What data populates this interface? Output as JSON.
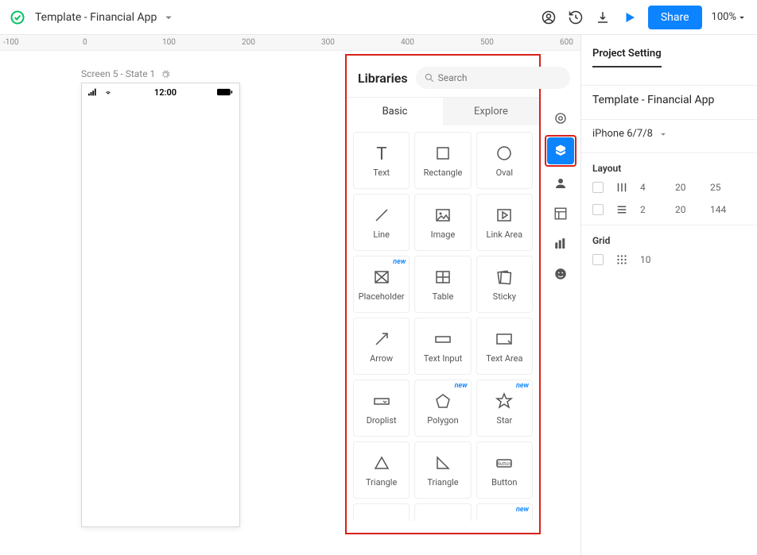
{
  "topbar": {
    "title": "Template - Financial App",
    "share_label": "Share",
    "zoom": "100%"
  },
  "ruler": {
    "ticks": [
      "-100",
      "0",
      "100",
      "200",
      "300",
      "400",
      "500",
      "600"
    ]
  },
  "canvas": {
    "screen_label": "Screen 5 - State 1",
    "status_time": "12:00"
  },
  "libraries": {
    "title": "Libraries",
    "search_placeholder": "Search",
    "tabs": {
      "basic": "Basic",
      "explore": "Explore"
    },
    "items": [
      {
        "label": "Text",
        "icon": "text",
        "new": false
      },
      {
        "label": "Rectangle",
        "icon": "rect",
        "new": false
      },
      {
        "label": "Oval",
        "icon": "oval",
        "new": false
      },
      {
        "label": "Line",
        "icon": "line",
        "new": false
      },
      {
        "label": "Image",
        "icon": "image",
        "new": false
      },
      {
        "label": "Link Area",
        "icon": "linkarea",
        "new": false
      },
      {
        "label": "Placeholder",
        "icon": "placeholder",
        "new": true
      },
      {
        "label": "Table",
        "icon": "table",
        "new": false
      },
      {
        "label": "Sticky",
        "icon": "sticky",
        "new": false
      },
      {
        "label": "Arrow",
        "icon": "arrow",
        "new": false
      },
      {
        "label": "Text Input",
        "icon": "textinput",
        "new": false
      },
      {
        "label": "Text Area",
        "icon": "textarea",
        "new": false
      },
      {
        "label": "Droplist",
        "icon": "droplist",
        "new": false
      },
      {
        "label": "Polygon",
        "icon": "polygon",
        "new": true
      },
      {
        "label": "Star",
        "icon": "star",
        "new": true
      },
      {
        "label": "Triangle",
        "icon": "triangle",
        "new": false
      },
      {
        "label": "Triangle",
        "icon": "triangle-r",
        "new": false
      },
      {
        "label": "Button",
        "icon": "button",
        "new": false
      },
      {
        "label": "",
        "icon": "carousel",
        "new": false
      },
      {
        "label": "",
        "icon": "window",
        "new": false
      },
      {
        "label": "",
        "icon": "video",
        "new": true
      }
    ],
    "new_badge": "new"
  },
  "right_panel": {
    "heading": "Project Setting",
    "project_name": "Template - Financial App",
    "device": "iPhone 6/7/8",
    "layout_label": "Layout",
    "layout_rows": [
      {
        "v1": "4",
        "v2": "20",
        "v3": "25"
      },
      {
        "v1": "2",
        "v2": "20",
        "v3": "144"
      }
    ],
    "grid_label": "Grid",
    "grid_value": "10"
  }
}
